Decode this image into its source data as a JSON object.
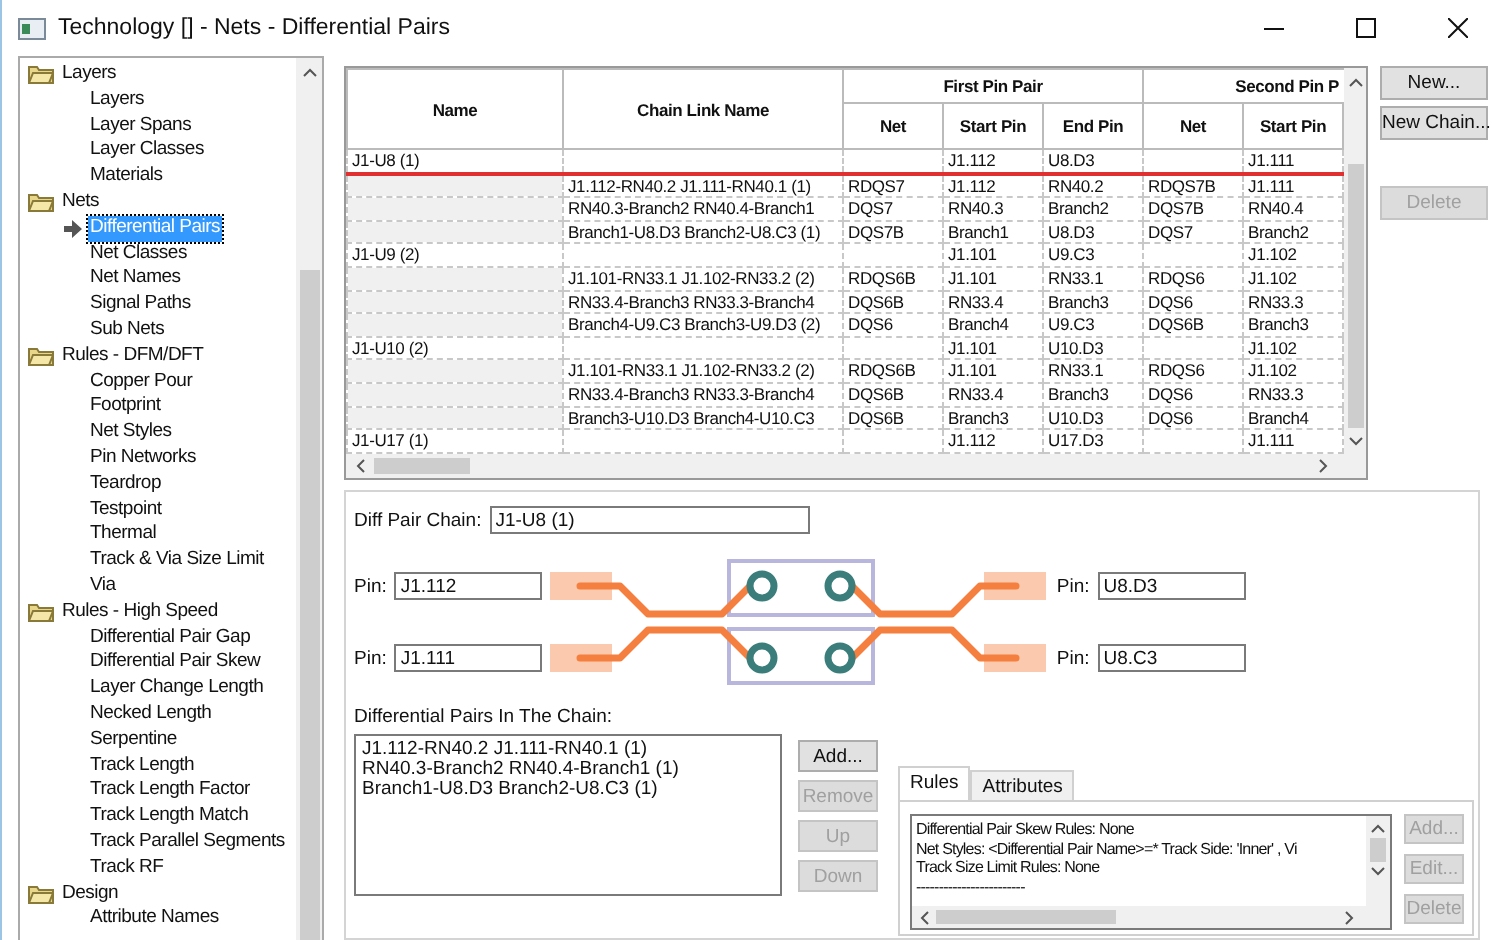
{
  "window": {
    "title": "Technology []  - Nets - Differential Pairs"
  },
  "tree": [
    {
      "label": "Layers",
      "expanded": true,
      "children": [
        {
          "label": "Layers",
          "selected": false
        },
        {
          "label": "Layer Spans",
          "selected": false
        },
        {
          "label": "Layer Classes",
          "selected": false
        },
        {
          "label": "Materials",
          "selected": false
        }
      ]
    },
    {
      "label": "Nets",
      "expanded": true,
      "children": [
        {
          "label": "Differential Pairs",
          "selected": true
        },
        {
          "label": "Net Classes",
          "selected": false
        },
        {
          "label": "Net Names",
          "selected": false
        },
        {
          "label": "Signal Paths",
          "selected": false
        },
        {
          "label": "Sub Nets",
          "selected": false
        }
      ]
    },
    {
      "label": "Rules - DFM/DFT",
      "expanded": true,
      "children": [
        {
          "label": "Copper Pour",
          "selected": false
        },
        {
          "label": "Footprint",
          "selected": false
        },
        {
          "label": "Net Styles",
          "selected": false
        },
        {
          "label": "Pin Networks",
          "selected": false
        },
        {
          "label": "Teardrop",
          "selected": false
        },
        {
          "label": "Testpoint",
          "selected": false
        },
        {
          "label": "Thermal",
          "selected": false
        },
        {
          "label": "Track & Via Size Limit",
          "selected": false
        },
        {
          "label": "Via",
          "selected": false
        }
      ]
    },
    {
      "label": "Rules - High Speed",
      "expanded": true,
      "children": [
        {
          "label": "Differential Pair Gap",
          "selected": false
        },
        {
          "label": "Differential Pair Skew",
          "selected": false
        },
        {
          "label": "Layer Change Length",
          "selected": false
        },
        {
          "label": "Necked Length",
          "selected": false
        },
        {
          "label": "Serpentine",
          "selected": false
        },
        {
          "label": "Track Length",
          "selected": false
        },
        {
          "label": "Track Length Factor",
          "selected": false
        },
        {
          "label": "Track Length Match",
          "selected": false
        },
        {
          "label": "Track Parallel Segments",
          "selected": false
        },
        {
          "label": "Track RF",
          "selected": false
        }
      ]
    },
    {
      "label": "Design",
      "expanded": true,
      "children": [
        {
          "label": "Attribute Names",
          "selected": false
        }
      ]
    }
  ],
  "table": {
    "columns": [
      "Name",
      "Chain Link Name"
    ],
    "groups": [
      {
        "label": "First Pin Pair",
        "columns": [
          "Net",
          "Start Pin",
          "End Pin"
        ]
      },
      {
        "label": "Second Pin P",
        "columns": [
          "Net",
          "Start Pin"
        ]
      }
    ],
    "rows": [
      {
        "kind": "chain",
        "selected": true,
        "cells": [
          "J1-U8 (1)",
          "",
          "",
          "J1.112",
          "U8.D3",
          "",
          "J1.111"
        ]
      },
      {
        "kind": "link",
        "selected": false,
        "cells": [
          "",
          "J1.112-RN40.2 J1.111-RN40.1 (1)",
          "RDQS7",
          "J1.112",
          "RN40.2",
          "RDQS7B",
          "J1.111"
        ]
      },
      {
        "kind": "link",
        "selected": false,
        "cells": [
          "",
          "RN40.3-Branch2 RN40.4-Branch1",
          "DQS7",
          "RN40.3",
          "Branch2",
          "DQS7B",
          "RN40.4"
        ]
      },
      {
        "kind": "link",
        "selected": false,
        "cells": [
          "",
          "Branch1-U8.D3 Branch2-U8.C3 (1)",
          "DQS7B",
          "Branch1",
          "U8.D3",
          "DQS7",
          "Branch2"
        ]
      },
      {
        "kind": "chain",
        "selected": false,
        "cells": [
          "J1-U9 (2)",
          "",
          "",
          "J1.101",
          "U9.C3",
          "",
          "J1.102"
        ]
      },
      {
        "kind": "link",
        "selected": false,
        "cells": [
          "",
          "J1.101-RN33.1 J1.102-RN33.2 (2)",
          "RDQS6B",
          "J1.101",
          "RN33.1",
          "RDQS6",
          "J1.102"
        ]
      },
      {
        "kind": "link",
        "selected": false,
        "cells": [
          "",
          "RN33.4-Branch3 RN33.3-Branch4",
          "DQS6B",
          "RN33.4",
          "Branch3",
          "DQS6",
          "RN33.3"
        ]
      },
      {
        "kind": "link",
        "selected": false,
        "cells": [
          "",
          "Branch4-U9.C3 Branch3-U9.D3 (2)",
          "DQS6",
          "Branch4",
          "U9.C3",
          "DQS6B",
          "Branch3"
        ]
      },
      {
        "kind": "chain",
        "selected": false,
        "cells": [
          "J1-U10 (2)",
          "",
          "",
          "J1.101",
          "U10.D3",
          "",
          "J1.102"
        ]
      },
      {
        "kind": "link",
        "selected": false,
        "cells": [
          "",
          "J1.101-RN33.1 J1.102-RN33.2 (2)",
          "RDQS6B",
          "J1.101",
          "RN33.1",
          "RDQS6",
          "J1.102"
        ]
      },
      {
        "kind": "link",
        "selected": false,
        "cells": [
          "",
          "RN33.4-Branch3 RN33.3-Branch4",
          "DQS6B",
          "RN33.4",
          "Branch3",
          "DQS6",
          "RN33.3"
        ]
      },
      {
        "kind": "link",
        "selected": false,
        "cells": [
          "",
          "Branch3-U10.D3 Branch4-U10.C3",
          "DQS6B",
          "Branch3",
          "U10.D3",
          "DQS6",
          "Branch4"
        ]
      },
      {
        "kind": "chain",
        "selected": false,
        "cells": [
          "J1-U17 (1)",
          "",
          "",
          "J1.112",
          "U17.D3",
          "",
          "J1.111"
        ]
      }
    ]
  },
  "side_buttons": [
    {
      "label": "New...",
      "disabled": false
    },
    {
      "label": "New Chain...",
      "disabled": false
    },
    {
      "label": "Delete",
      "disabled": true
    }
  ],
  "detail": {
    "chain_label": "Diff Pair Chain:",
    "chain_value": "J1-U8 (1)",
    "left_pins": [
      {
        "label": "Pin:",
        "value": "J1.112"
      },
      {
        "label": "Pin:",
        "value": "J1.111"
      }
    ],
    "right_pins": [
      {
        "label": "Pin:",
        "value": "U8.D3"
      },
      {
        "label": "Pin:",
        "value": "U8.C3"
      }
    ],
    "list_label": "Differential Pairs In The Chain:",
    "list_items": [
      "J1.112-RN40.2 J1.111-RN40.1 (1)",
      "RN40.3-Branch2 RN40.4-Branch1 (1)",
      "Branch1-U8.D3 Branch2-U8.C3 (1)"
    ],
    "list_buttons": [
      {
        "label": "Add...",
        "disabled": false
      },
      {
        "label": "Remove",
        "disabled": true
      },
      {
        "label": "Up",
        "disabled": true
      },
      {
        "label": "Down",
        "disabled": true
      }
    ],
    "tabs": [
      {
        "label": "Rules",
        "selected": true
      },
      {
        "label": "Attributes",
        "selected": false
      }
    ],
    "rules_lines": [
      "Differential Pair Skew Rules: None",
      "Net Styles: <Differential Pair Name>=*  Track Side: 'Inner' , Vi",
      "Track Size Limit Rules: None",
      "------------------------"
    ],
    "rule_buttons": [
      {
        "label": "Add...",
        "disabled": true
      },
      {
        "label": "Edit...",
        "disabled": true
      },
      {
        "label": "Delete",
        "disabled": true
      }
    ]
  }
}
